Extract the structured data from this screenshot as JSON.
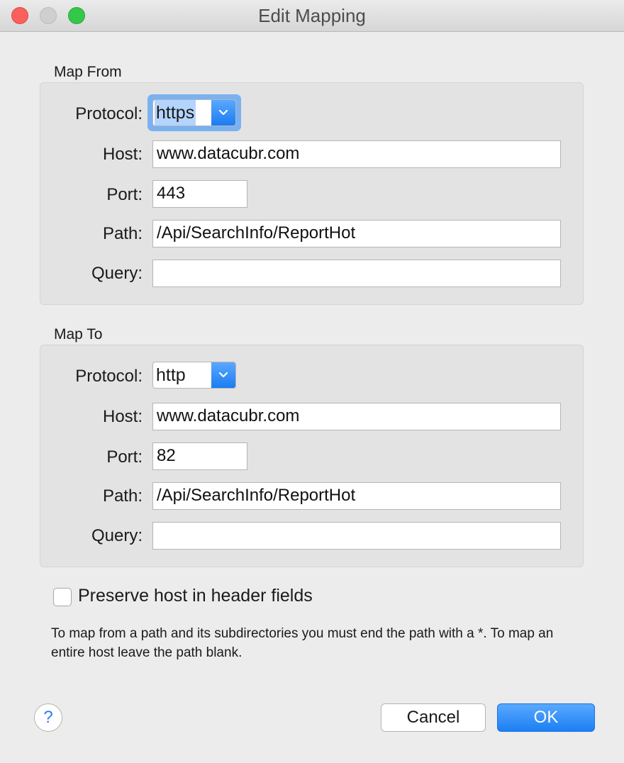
{
  "window": {
    "title": "Edit Mapping"
  },
  "map_from": {
    "label": "Map From",
    "protocol_label": "Protocol:",
    "protocol_value": "https",
    "host_label": "Host:",
    "host_value": "www.datacubr.com",
    "port_label": "Port:",
    "port_value": "443",
    "path_label": "Path:",
    "path_value": "/Api/SearchInfo/ReportHot",
    "query_label": "Query:",
    "query_value": ""
  },
  "map_to": {
    "label": "Map To",
    "protocol_label": "Protocol:",
    "protocol_value": "http",
    "host_label": "Host:",
    "host_value": "www.datacubr.com",
    "port_label": "Port:",
    "port_value": "82",
    "path_label": "Path:",
    "path_value": "/Api/SearchInfo/ReportHot",
    "query_label": "Query:",
    "query_value": ""
  },
  "options": {
    "preserve_host_label": "Preserve host in header fields",
    "preserve_host_checked": false
  },
  "note": "To map from a path and its subdirectories you must end the path with a *. To map an entire host leave the path blank.",
  "buttons": {
    "help": "?",
    "cancel": "Cancel",
    "ok": "OK"
  },
  "colors": {
    "accent": "#1c7ff3",
    "close": "#fc605c",
    "maximize": "#34c84a"
  },
  "icons": {
    "help": "question-icon",
    "dropdown": "chevron-down-icon"
  }
}
